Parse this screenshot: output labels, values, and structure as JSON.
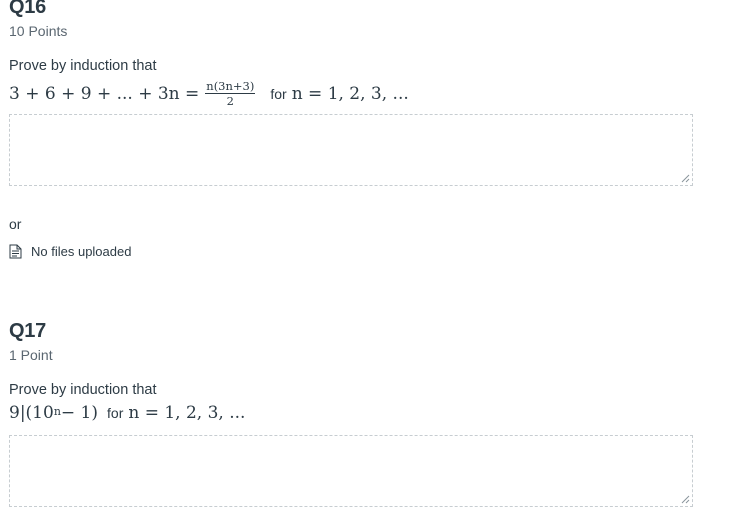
{
  "q16": {
    "title": "Q16",
    "points": "10 Points",
    "prompt": "Prove by induction that",
    "math_lhs": "3 + 6 + 9 + ... + 3n =",
    "frac_num": "n(3n+3)",
    "frac_den": "2",
    "for_text": "for",
    "math_rhs": "n = 1, 2, 3, ...",
    "answer_value": ""
  },
  "or_text": "or",
  "upload": {
    "icon": "document-icon",
    "status": "No files uploaded"
  },
  "q17": {
    "title": "Q17",
    "points": "1 Point",
    "prompt": "Prove by induction that",
    "math_lhs": "9|(10",
    "math_exp": "n",
    "math_lhs_end": " − 1)",
    "for_text": "for",
    "math_rhs": "n = 1, 2, 3, ...",
    "answer_value": ""
  },
  "colors": {
    "text": "#2d3b45",
    "muted": "#5a6670",
    "border": "#c7cdd1"
  }
}
